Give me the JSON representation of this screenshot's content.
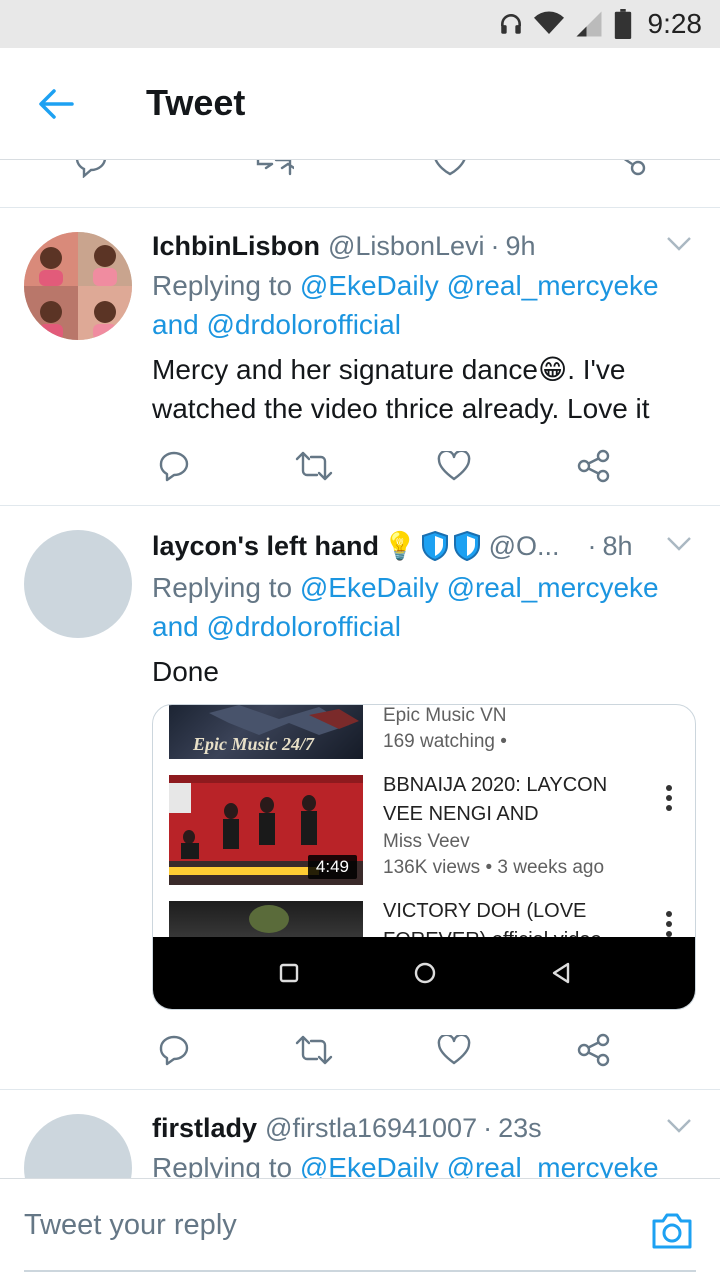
{
  "status_bar": {
    "time": "9:28",
    "icons": [
      "headphones-icon",
      "wifi-icon",
      "signal-icon",
      "battery-icon"
    ]
  },
  "header": {
    "title": "Tweet"
  },
  "tweets": [
    {
      "display_name": "IchbinLisbon",
      "handle": "@LisbonLevi",
      "separator": "·",
      "time": "9h",
      "replying_prefix": "Replying to",
      "mentions": [
        "@EkeDaily",
        "@real_mercyeke"
      ],
      "and_word": "and",
      "mention3": "@drdolorofficial",
      "text_line1": "Mercy and her signature dance",
      "emoji": "😁",
      "text_line1_end": ". I've",
      "text_line2": "watched the video thrice already. Love it"
    },
    {
      "display_name": "laycon's left hand",
      "emojis": "💡",
      "handle": "@O...",
      "separator": "·",
      "time": "8h",
      "replying_prefix": "Replying to",
      "mentions": [
        "@EkeDaily",
        "@real_mercyeke"
      ],
      "and_word": "and",
      "mention3": "@drdolorofficial",
      "text": "Done",
      "card": {
        "items": [
          {
            "thumb_caption": "Epic Music 24/7",
            "channel": "Epic Music VN",
            "stats": "169 watching •"
          },
          {
            "title_line1": "BBNAIJA 2020: LAYCON",
            "title_line2": "VEE NENGI AND",
            "channel": "Miss Veev",
            "stats": "136K views • 3 weeks ago",
            "duration": "4:49"
          },
          {
            "title_line1": "VICTORY DOH  (LOVE",
            "title_line2": "FOREVER)  official video"
          }
        ]
      }
    },
    {
      "display_name": "firstlady",
      "handle": "@firstla16941007",
      "separator": "·",
      "time": "23s",
      "replying_prefix": "Replying to",
      "mentions": [
        "@EkeDaily",
        "@real_mercyeke"
      ]
    }
  ],
  "composer": {
    "placeholder": "Tweet your reply"
  },
  "colors": {
    "accent": "#1da1f2",
    "mention": "#1b95e0",
    "muted": "#657786",
    "text": "#14171a"
  }
}
